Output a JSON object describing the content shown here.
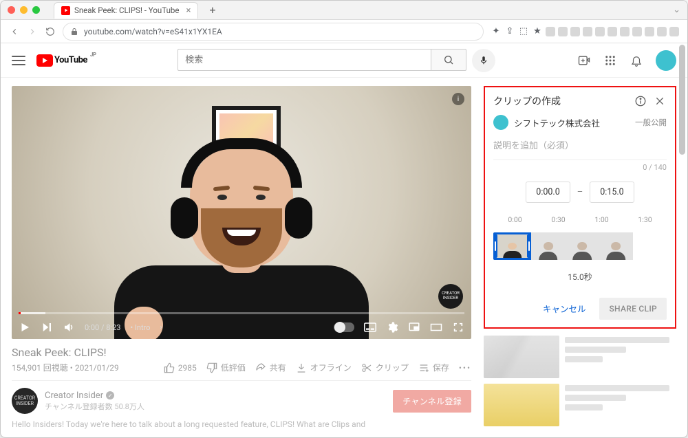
{
  "browser": {
    "tab_title": "Sneak Peek: CLIPS! - YouTube",
    "url": "youtube.com/watch?v=eS41x1YX1EA"
  },
  "masthead": {
    "logo_text": "YouTube",
    "logo_region": "JP",
    "search_placeholder": "検索"
  },
  "player": {
    "current_time": "0:00",
    "duration": "8:23",
    "chapter_label": "• Intro",
    "channel_badge": "CREATOR INSIDER",
    "info_char": "i"
  },
  "video": {
    "title": "Sneak Peek: CLIPS!",
    "views": "154,901 回視聴",
    "date": "2021/01/29",
    "like_count": "2985",
    "dislike_label": "低評価",
    "share_label": "共有",
    "offline_label": "オフライン",
    "clip_label": "クリップ",
    "save_label": "保存"
  },
  "channel": {
    "name": "Creator Insider",
    "subscribers": "チャンネル登録者数 50.8万人",
    "subscribe_label": "チャンネル登録",
    "avatar_text": "CREATOR INSIDER"
  },
  "description_snippet": "Hello Insiders! Today we're here to talk about a long requested feature, CLIPS! What are Clips and",
  "clip_panel": {
    "title": "クリップの作成",
    "channel_name": "シフトテック株式会社",
    "visibility": "一般公開",
    "desc_placeholder": "説明を追加（必須）",
    "char_count": "0 / 140",
    "start_time": "0:00.0",
    "end_time": "0:15.0",
    "ticks": [
      "0:00",
      "0:30",
      "1:00",
      "1:30"
    ],
    "duration": "15.0秒",
    "cancel_label": "キャンセル",
    "share_label": "SHARE CLIP"
  }
}
